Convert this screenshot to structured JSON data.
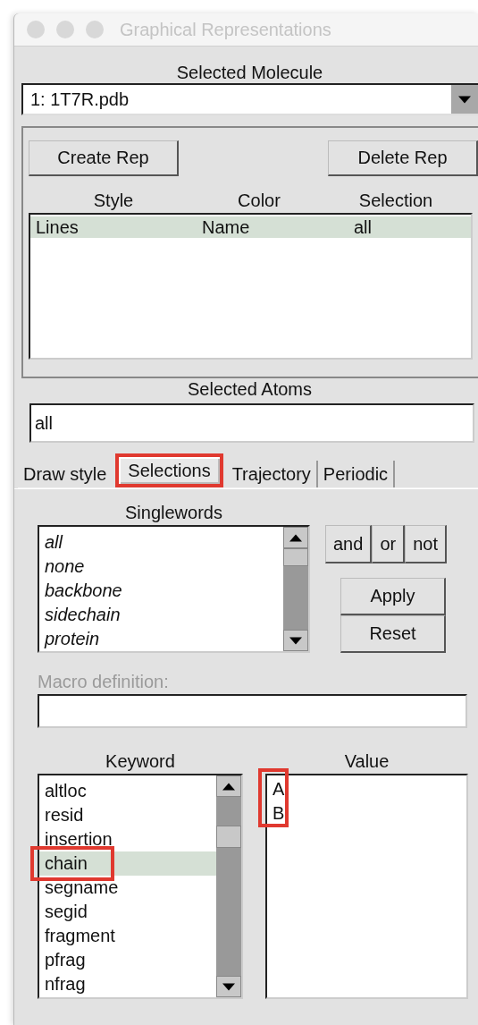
{
  "window": {
    "title": "Graphical Representations"
  },
  "molecule": {
    "label": "Selected Molecule",
    "value": "1: 1T7R.pdb"
  },
  "rep_buttons": [
    "Create Rep",
    "Delete Rep"
  ],
  "rep_table": {
    "columns": [
      "Style",
      "Color",
      "Selection"
    ],
    "rows": [
      {
        "cells": [
          "Lines",
          "Name",
          "all"
        ],
        "selected": true
      }
    ]
  },
  "selected_atoms": {
    "label": "Selected Atoms",
    "value": "all"
  },
  "tabs": [
    {
      "label": "Draw style",
      "selected": false,
      "annotated": false
    },
    {
      "label": "Selections",
      "selected": true,
      "annotated": true
    },
    {
      "label": "Trajectory",
      "selected": false,
      "annotated": false
    },
    {
      "label": "Periodic",
      "selected": false,
      "annotated": false
    }
  ],
  "singlewords": {
    "label": "Singlewords",
    "items": [
      "all",
      "none",
      "backbone",
      "sidechain",
      "protein"
    ]
  },
  "operators": [
    "and",
    "or",
    "not"
  ],
  "actions": [
    "Apply",
    "Reset"
  ],
  "macro": {
    "label": "Macro definition:",
    "disabled": true
  },
  "keywords": {
    "label": "Keyword",
    "items": [
      {
        "text": "altloc",
        "selected": false,
        "annotated": false
      },
      {
        "text": "resid",
        "selected": false,
        "annotated": false
      },
      {
        "text": "insertion",
        "selected": false,
        "annotated": false
      },
      {
        "text": "chain",
        "selected": true,
        "annotated": true
      },
      {
        "text": "segname",
        "selected": false,
        "annotated": false
      },
      {
        "text": "segid",
        "selected": false,
        "annotated": false
      },
      {
        "text": "fragment",
        "selected": false,
        "annotated": false
      },
      {
        "text": "pfrag",
        "selected": false,
        "annotated": false
      },
      {
        "text": "nfrag",
        "selected": false,
        "annotated": false
      }
    ]
  },
  "values": {
    "label": "Value",
    "items": [
      {
        "text": "A",
        "annotated": true
      },
      {
        "text": "B",
        "annotated": true
      }
    ]
  }
}
